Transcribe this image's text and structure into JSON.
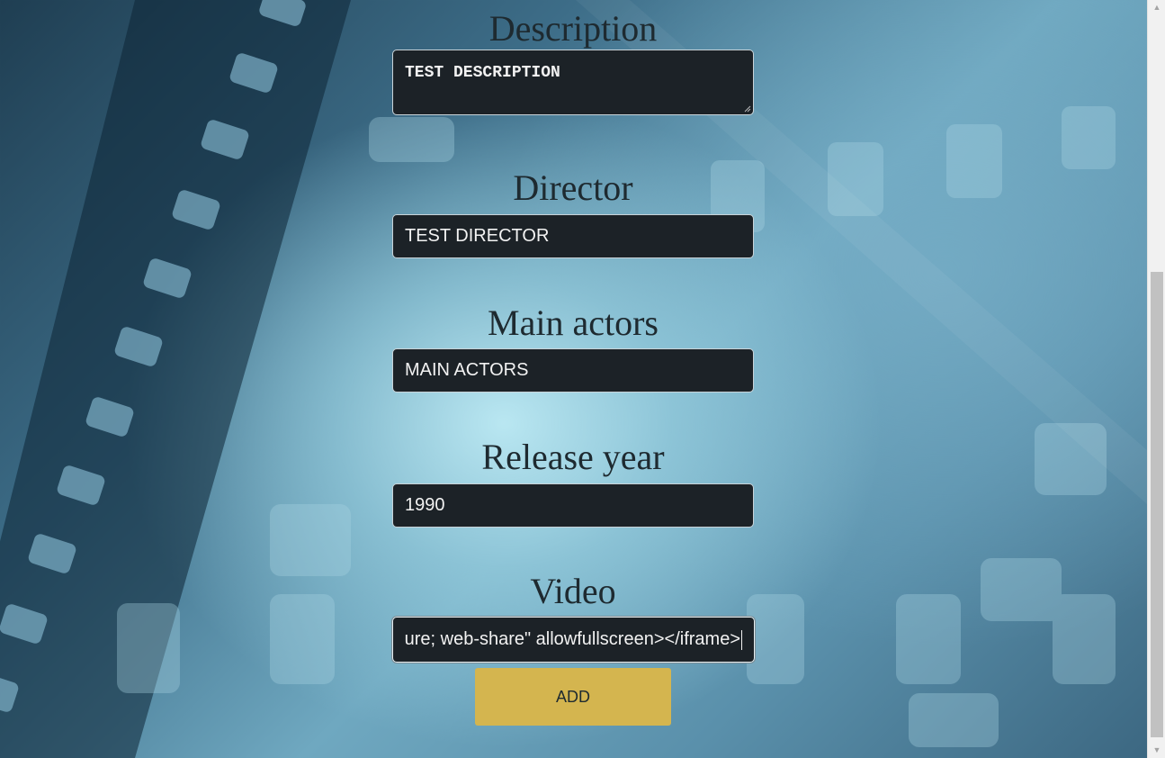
{
  "form": {
    "description": {
      "label": "Description",
      "value": "TEST DESCRIPTION"
    },
    "director": {
      "label": "Director",
      "value": "TEST DIRECTOR"
    },
    "main_actors": {
      "label": "Main actors",
      "value": "MAIN ACTORS"
    },
    "release_year": {
      "label": "Release year",
      "value": "1990"
    },
    "video": {
      "label": "Video",
      "value": "ure; web-share\" allowfullscreen></iframe>"
    },
    "add_label": "ADD"
  },
  "colors": {
    "field_bg": "#1c2227",
    "button": "#d4b54f",
    "label_text": "#1e2a30"
  },
  "icons": {
    "scroll_up": "scroll-up-arrow-icon",
    "scroll_down": "scroll-down-arrow-icon",
    "resize": "resize-grip-icon"
  }
}
